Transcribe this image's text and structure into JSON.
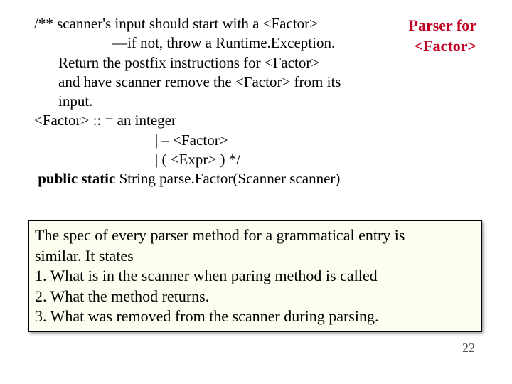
{
  "code": {
    "l1": "/**  scanner's input should start with a <Factor>",
    "l2": "—if not, throw a Runtime.Exception.",
    "l3": "Return the postfix instructions for <Factor>",
    "l4": "and have scanner remove the <Factor> from its input.",
    "l5": "<Factor> :: = an integer",
    "l6": "|    – <Factor>",
    "l7": "|    (   <Expr>   )           */",
    "l8a": "public static",
    "l8b": " String parse.Factor(Scanner scanner)"
  },
  "callout": {
    "line1": "Parser for",
    "line2": "<Factor>"
  },
  "note": {
    "intro1": "The spec of  every parser method for a grammatical entry is",
    "intro2": "similar. It states",
    "item1": "1.   What is in the scanner when paring method is called",
    "item2": "2.   What the method returns.",
    "item3": "3.   What was removed from the scanner during parsing."
  },
  "page": "22"
}
